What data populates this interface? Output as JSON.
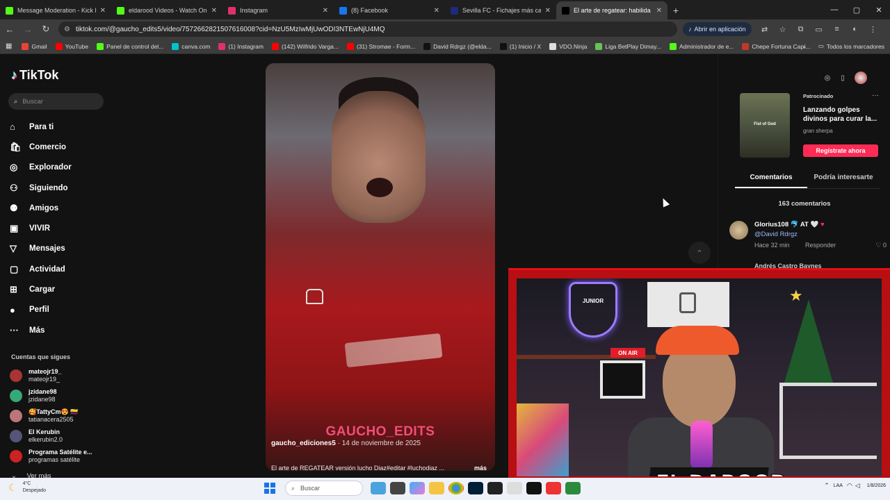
{
  "browser": {
    "tabs": [
      {
        "title": "Message Moderation - Kick Da",
        "color": "#53fc18",
        "active": false
      },
      {
        "title": "eldarood Videos - Watch On-D",
        "color": "#53fc18",
        "active": false
      },
      {
        "title": "Instagram",
        "color": "#e1306c",
        "active": false
      },
      {
        "title": "(8) Facebook",
        "color": "#1877f2",
        "active": false
      },
      {
        "title": "Sevilla FC - Fichajes más caros",
        "color": "#202a7a",
        "active": false
      },
      {
        "title": "El arte de regatear: habilida",
        "color": "#000000",
        "active": true
      }
    ],
    "url": "tiktok.com/@gaucho_edits5/video/7572662821507616008?cid=NzU5MzIwMjUwODI3NTEwNjU4MQ",
    "open_app_label": "Abrir en aplicación",
    "bookmarks": [
      {
        "label": "Gmail",
        "color": "#ea4335"
      },
      {
        "label": "YouTube",
        "color": "#ff0000"
      },
      {
        "label": "Panel de control del...",
        "color": "#53fc18"
      },
      {
        "label": "canva.com",
        "color": "#00c4cc"
      },
      {
        "label": "(1) Instagram",
        "color": "#e1306c"
      },
      {
        "label": "(142) Wilfrido Varga...",
        "color": "#ff0000"
      },
      {
        "label": "(31) Stromae - Form...",
        "color": "#ff0000"
      },
      {
        "label": "David Rdrgz (@elda...",
        "color": "#111111"
      },
      {
        "label": "(1) Inicio / X",
        "color": "#111111"
      },
      {
        "label": "VDO.Ninja",
        "color": "#dddddd"
      },
      {
        "label": "Liga BetPlay Dimay...",
        "color": "#6ac259"
      },
      {
        "label": "Administrador de e...",
        "color": "#53fc18"
      },
      {
        "label": "Chepe Fortuna Capí...",
        "color": "#c0392b"
      }
    ],
    "all_bookmarks_label": "Todos los marcadores"
  },
  "tiktok": {
    "logo": "TikTok",
    "search_placeholder": "Buscar",
    "nav": [
      {
        "label": "Para ti",
        "icon": "home-icon"
      },
      {
        "label": "Comercio",
        "icon": "shop-icon"
      },
      {
        "label": "Explorador",
        "icon": "compass-icon"
      },
      {
        "label": "Siguiendo",
        "icon": "following-icon"
      },
      {
        "label": "Amigos",
        "icon": "friends-icon"
      },
      {
        "label": "VIVIR",
        "icon": "live-icon"
      },
      {
        "label": "Mensajes",
        "icon": "messages-icon"
      },
      {
        "label": "Actividad",
        "icon": "activity-icon"
      },
      {
        "label": "Cargar",
        "icon": "upload-icon"
      },
      {
        "label": "Perfil",
        "icon": "profile-icon"
      },
      {
        "label": "Más",
        "icon": "more-icon"
      }
    ],
    "following_title": "Cuentas que sigues",
    "following": [
      {
        "name": "mateojr19_",
        "handle": "mateojr19_",
        "color": "#a33"
      },
      {
        "name": "jzidane98",
        "handle": "jzidane98",
        "color": "#3a7"
      },
      {
        "name": "🥰TattyCm😍 🇨🇴",
        "handle": "tatianacera2505",
        "color": "#b77"
      },
      {
        "name": "El Kerubin",
        "handle": "elkerubin2.0",
        "color": "#557"
      },
      {
        "name": "Programa Satélite e...",
        "handle": "programas satélite",
        "color": "#c22"
      }
    ],
    "see_more": "Ver más",
    "video": {
      "watermark": "GAUCHO_EDITS",
      "creator": "gaucho_ediciones5",
      "date": " · 14 de noviembre de 2025",
      "caption": "El arte de REGATEAR versión lucho Diaz#editar #luchodiaz ...",
      "more": "más"
    },
    "ad": {
      "tag": "Patrocinado",
      "image_label": "Fist of God",
      "title": "Lanzando golpes divinos para curar la...",
      "brand": "gran sherpa",
      "cta": "Regístrate ahora"
    },
    "right_tabs": [
      {
        "label": "Comentarios",
        "active": true
      },
      {
        "label": "Podría interesarte",
        "active": false
      }
    ],
    "comment_count": "163 comentarios",
    "comments": [
      {
        "user": "Glorius108",
        "badges": "🐬 AT 🤍",
        "mention": "@David Rdrgz",
        "time": "Hace 32 min",
        "reply": "Responder",
        "likes": "0"
      }
    ],
    "next_commenter": "Andrés Castro Baynes"
  },
  "stream": {
    "brand": "EL DAROOD",
    "neon": "JUNIOR",
    "onair": "ON AIR",
    "accent": "#e01015"
  },
  "taskbar": {
    "temp": "4°C",
    "weather": "Despejado",
    "search": "Buscar",
    "region": "LAA",
    "date": "1/8/2026"
  }
}
